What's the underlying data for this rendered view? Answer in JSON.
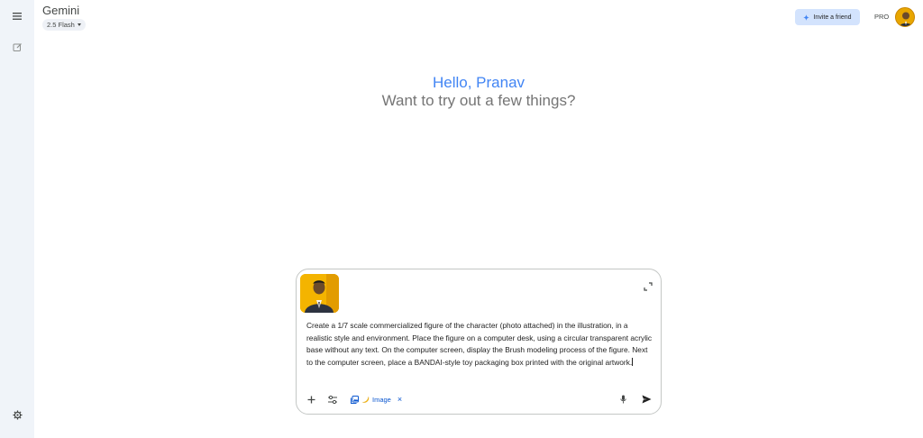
{
  "app": {
    "title": "Gemini",
    "model": "2.5 Flash"
  },
  "header": {
    "invite_label": "Invite a friend",
    "plan_badge": "PRO"
  },
  "greeting": {
    "hello": "Hello, Pranav",
    "sub": "Want to try out a few things?"
  },
  "composer": {
    "prompt": "Create a 1/7 scale commercialized figure of the character (photo attached) in the illustration, in a realistic style and environment. Place the figure on a computer desk, using a circular transparent acrylic base without any text. On the computer screen, display the Brush modeling process of the figure. Next to the computer screen, place a BANDAI-style toy packaging box printed with the original artwork.",
    "tool_chip": {
      "label": "Image",
      "icon": "banana-icon"
    }
  },
  "colors": {
    "accent": "#4285f4",
    "sidebar_bg": "#f0f4f9",
    "chip_text": "#0b57d0",
    "invite_bg": "#d3e3fd"
  }
}
